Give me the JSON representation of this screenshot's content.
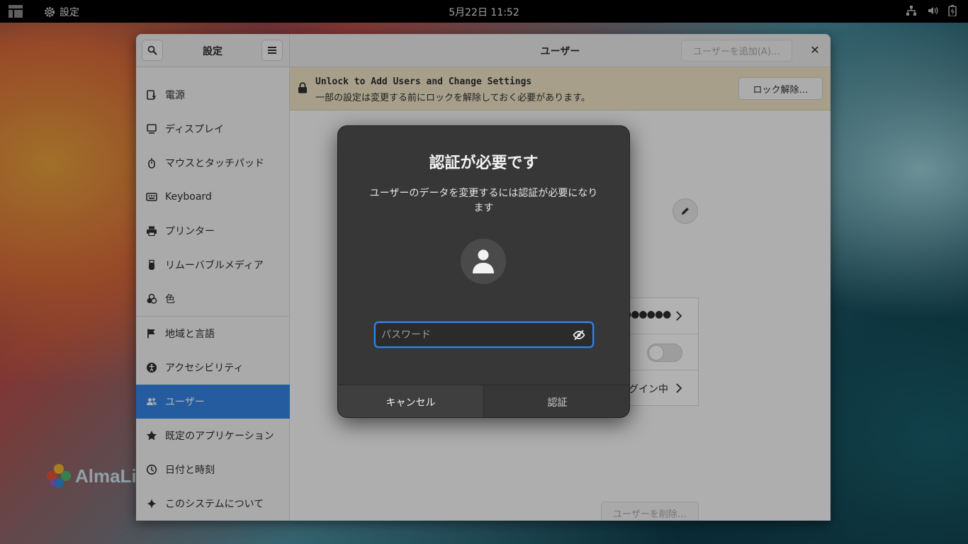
{
  "topbar": {
    "app_name": "設定",
    "clock": "5月22日  11:52"
  },
  "brand": {
    "text": "AlmaLi"
  },
  "window": {
    "sidebar_title": "設定",
    "title": "ユーザー",
    "add_user_label": "ユーザーを追加(A)…",
    "close_label": "✕"
  },
  "sidebar": {
    "items": [
      {
        "label": "電源",
        "icon": "power-icon"
      },
      {
        "label": "ディスプレイ",
        "icon": "display-icon"
      },
      {
        "label": "マウスとタッチパッド",
        "icon": "mouse-icon"
      },
      {
        "label": "Keyboard",
        "icon": "keyboard-icon"
      },
      {
        "label": "プリンター",
        "icon": "printer-icon"
      },
      {
        "label": "リムーバブルメディア",
        "icon": "removable-media-icon"
      },
      {
        "label": "色",
        "icon": "color-icon"
      },
      {
        "label": "地域と言語",
        "icon": "flag-icon"
      },
      {
        "label": "アクセシビリティ",
        "icon": "accessibility-icon"
      },
      {
        "label": "ユーザー",
        "icon": "users-icon",
        "active": true
      },
      {
        "label": "既定のアプリケーション",
        "icon": "star-icon"
      },
      {
        "label": "日付と時刻",
        "icon": "clock-icon"
      },
      {
        "label": "このシステムについて",
        "icon": "sparkle-icon"
      }
    ]
  },
  "lock_bar": {
    "title": "Unlock to Add Users and Change Settings",
    "subtitle": "一部の設定は変更する前にロックを解除しておく必要があります。",
    "unlock_label": "ロック解除…"
  },
  "user_panel": {
    "password_dots": "●●●●●●",
    "login_status": "ログイン中",
    "autologin_enabled": false,
    "delete_user_label": "ユーザーを削除…"
  },
  "dialog": {
    "title": "認証が必要です",
    "description": "ユーザーのデータを変更するには認証が必要になります",
    "password_placeholder": "パスワード",
    "password_value": "",
    "cancel_label": "キャンセル",
    "auth_label": "認証"
  },
  "colors": {
    "accent": "#3584e4",
    "dialog_bg": "#373737",
    "lock_bar_bg": "#f0e4c6"
  }
}
